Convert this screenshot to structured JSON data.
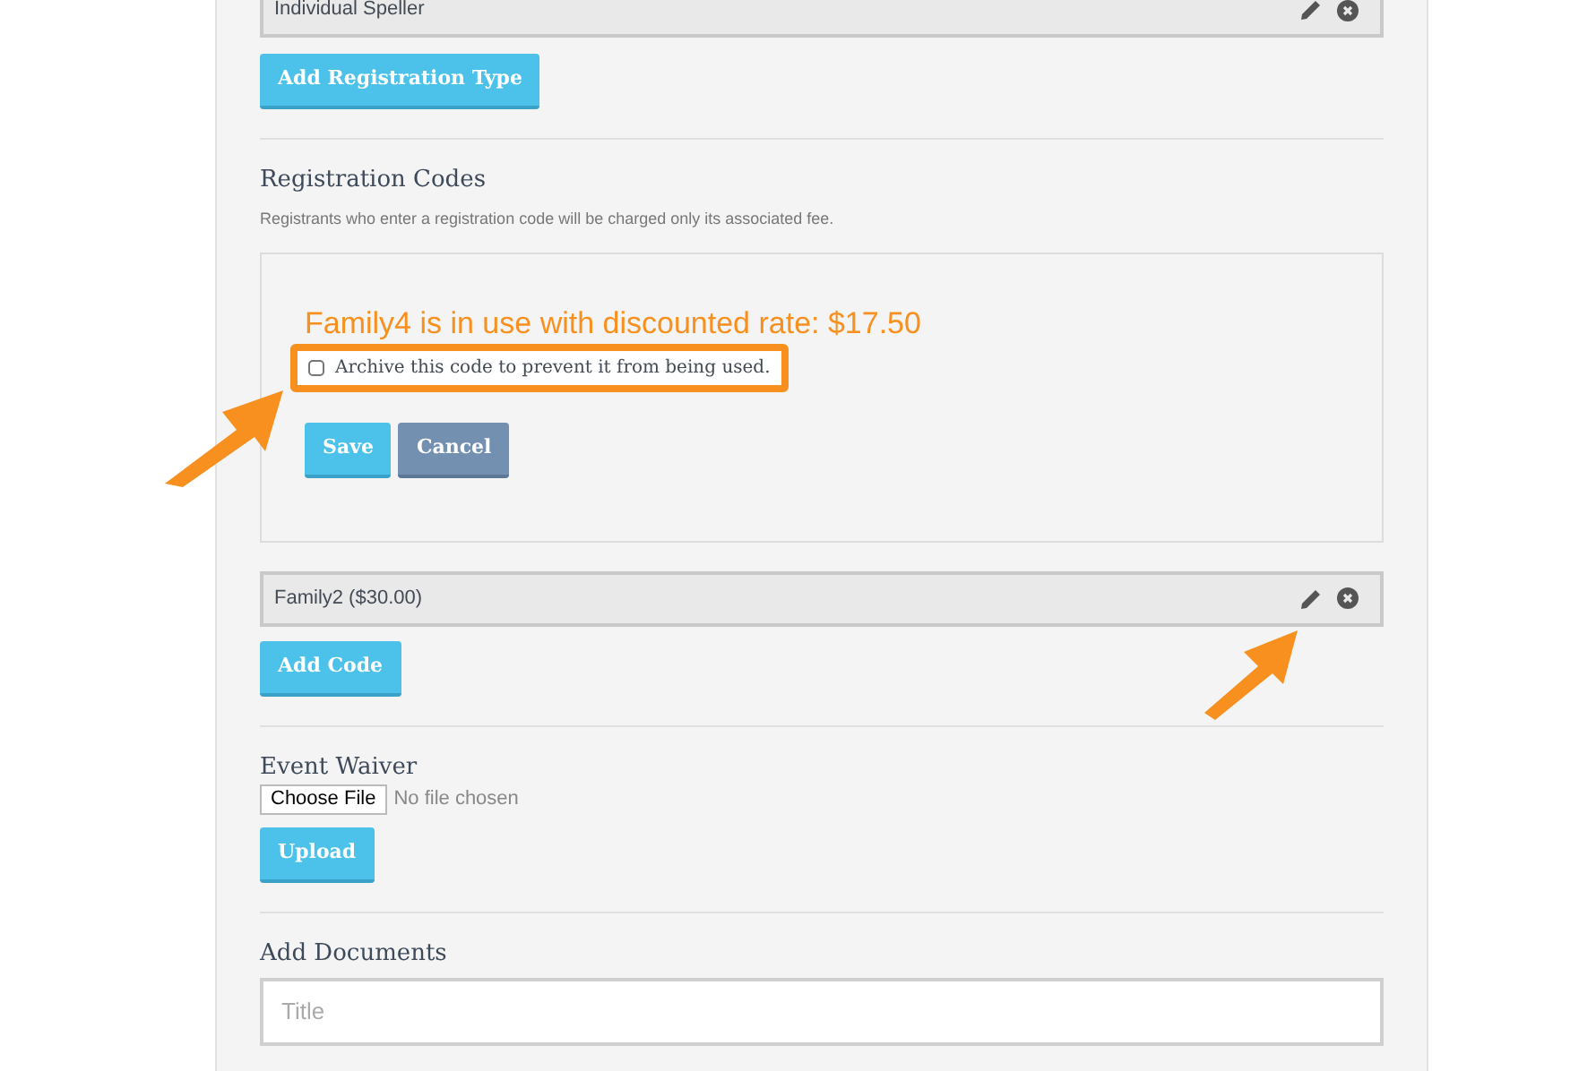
{
  "registration_types": [
    {
      "label": "Individual Speller"
    }
  ],
  "add_type_button": "Add Registration Type",
  "codes_section": {
    "heading": "Registration Codes",
    "description": "Registrants who enter a registration code will be charged only its associated fee."
  },
  "code_editor": {
    "message": "Family4 is in use with discounted rate: $17.50",
    "archive": {
      "label": "Archive this code to prevent it from being used.",
      "checked": false,
      "highlighted": true
    },
    "buttons": [
      {
        "label": "Save",
        "kind": "primary"
      },
      {
        "label": "Cancel",
        "kind": "secondary"
      }
    ]
  },
  "codes": [
    {
      "label": "Family2 ($30.00)"
    }
  ],
  "add_code_button": "Add Code",
  "waiver": {
    "heading": "Event Waiver",
    "choose_button": "Choose File",
    "file_status": "No file chosen",
    "upload_button": "Upload"
  },
  "documents": {
    "heading": "Add Documents",
    "title_field": {
      "placeholder": "Title"
    }
  }
}
